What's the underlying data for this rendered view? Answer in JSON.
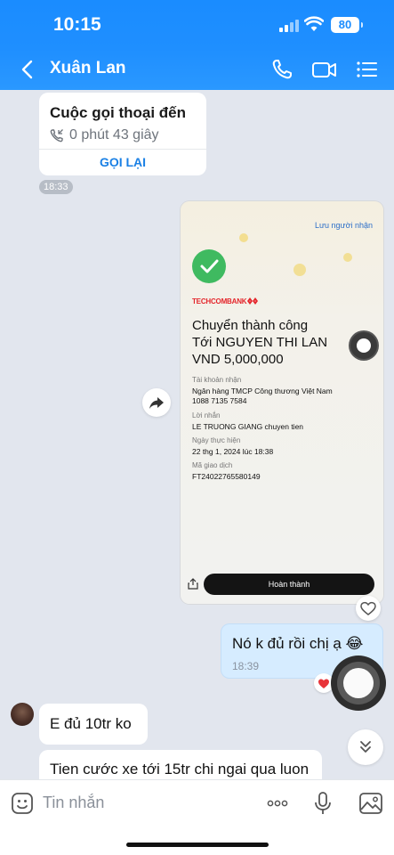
{
  "status": {
    "time": "10:15",
    "battery": "80"
  },
  "header": {
    "title": "Xuân Lan"
  },
  "call_card": {
    "title": "Cuộc gọi thoại đến",
    "duration": "0 phút 43 giây",
    "action": "GỌI LẠI",
    "time": "18:33"
  },
  "transfer_screenshot": {
    "save_recipient": "Lưu người nhận",
    "bank_brand": "TECHCOMBANK",
    "title_line1": "Chuyển thành công",
    "title_line2": "Tới NGUYEN THI LAN",
    "title_line3": "VND 5,000,000",
    "account_label": "Tài khoản nhận",
    "account_bank": "Ngân hàng TMCP Công thương Việt Nam",
    "account_number": "1088 7135 7584",
    "message_label": "Lời nhắn",
    "message_value": "LE TRUONG GIANG chuyen tien",
    "date_label": "Ngày thực hiện",
    "date_value": "22 thg 1, 2024 lúc 18:38",
    "code_label": "Mã giao dịch",
    "code_value": "FT24022765580149",
    "done_button": "Hoàn thành"
  },
  "outgoing_message": {
    "text": "Nó k đủ rồi chị ạ 😂",
    "time": "18:39"
  },
  "incoming_messages": [
    {
      "text": "E đủ 10tr ko"
    },
    {
      "text": "Tien cước xe tới 15tr chi ngai qua luon"
    }
  ],
  "composer": {
    "placeholder": "Tin nhắn"
  },
  "colors": {
    "header": "#1a8cff",
    "outgoing_bubble": "#d6ecff",
    "link": "#1a80e5",
    "chat_bg": "#e2e6ee"
  },
  "icons": [
    "back-icon",
    "phone-icon",
    "video-call-icon",
    "menu-icon",
    "forward-icon",
    "heart-icon",
    "chevron-double-down-icon",
    "sticker-icon",
    "more-icon",
    "microphone-icon",
    "image-icon"
  ]
}
